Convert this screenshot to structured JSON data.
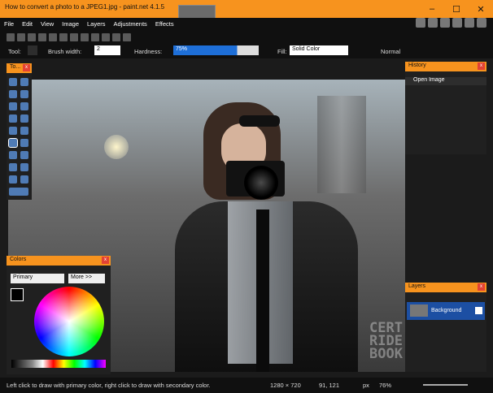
{
  "window": {
    "title": "How to convert a photo to a JPEG1.jpg - paint.net 4.1.5",
    "controls": [
      "–",
      "☐",
      "✕"
    ]
  },
  "menu": [
    "File",
    "Edit",
    "View",
    "Image",
    "Layers",
    "Adjustments",
    "Effects"
  ],
  "toolbar": {
    "tool_label": "Tool:",
    "brush_width_label": "Brush width:",
    "brush_width_value": "2",
    "hardness_label": "Hardness:",
    "hardness_value": "75%",
    "fill_label": "Fill:",
    "fill_value": "Solid Color",
    "blend_mode": "Normal"
  },
  "panels": {
    "tools_title": "To...",
    "history_title": "History",
    "history_items": [
      "Open Image"
    ],
    "layers_title": "Layers",
    "layer_name": "Background",
    "colors_title": "Colors",
    "color_mode": "Primary",
    "more_button": "More >>"
  },
  "status": {
    "hint": "Left click to draw with primary color, right click to draw with secondary color.",
    "image_size": "1280 × 720",
    "cursor_pos": "91, 121",
    "unit": "px",
    "zoom": "76%"
  },
  "watermark": [
    "CERT",
    "RIDE",
    "BOOK"
  ]
}
